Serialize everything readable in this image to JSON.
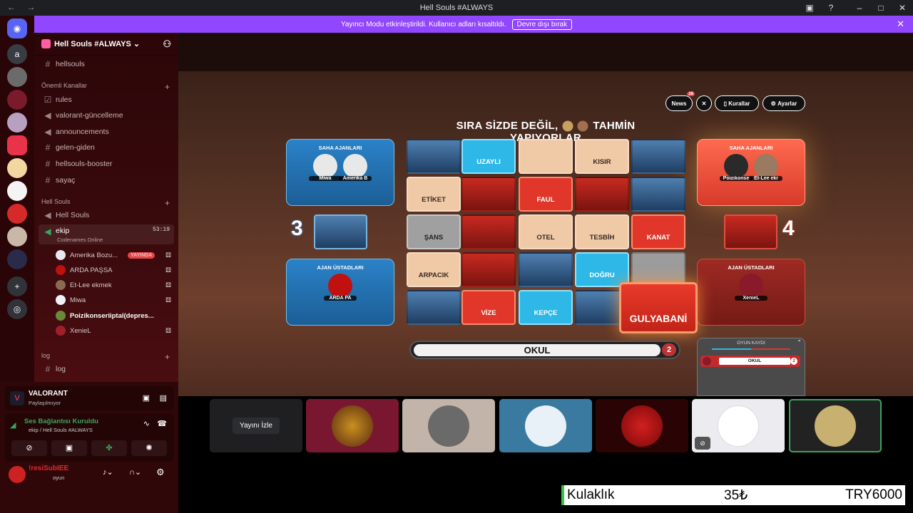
{
  "window": {
    "title": "Hell Souls #ALWAYS",
    "nav": "← →"
  },
  "banner": {
    "text": "Yayıncı Modu etkinleştirildi. Kullanıcı adları kısaltıldı.",
    "button": "Devre dışı bırak"
  },
  "servers": {
    "home_letter": "a"
  },
  "server": {
    "name": "Hell Souls #ALWAYS"
  },
  "channels": {
    "top": "hellsouls",
    "cat1": "Önemli Kanallar",
    "cat1_items": [
      "rules",
      "valorant-güncelleme",
      "announcements",
      "gelen-giden",
      "hellsouls-booster",
      "sayaç"
    ],
    "cat2": "Hell Souls",
    "voice1": "Hell Souls",
    "voice2": "ekip",
    "voice2_time": "53:19",
    "voice2_activity": "Codenames Online",
    "cat3": "log",
    "log": "log"
  },
  "voice_users": [
    {
      "name": "Amerika Bozu...",
      "badge": "YAYINDA",
      "color": "#e8e8f0"
    },
    {
      "name": "ARDA PAŞSA",
      "color": "#c01010"
    },
    {
      "name": "Et-Lee ekmek",
      "color": "#8a6a50"
    },
    {
      "name": "Miwa",
      "color": "#f0f0f8"
    },
    {
      "name": "Poizikonseriiptal(depres...",
      "color": "#6a8a3a"
    },
    {
      "name": "XenieL",
      "color": "#a0202a"
    }
  ],
  "activity": {
    "game": "VALORANT",
    "status": "Paylaşılmıyor"
  },
  "connection": {
    "status": "Ses Bağlantısı Kuruldu",
    "channel": "ekip / Hell Souls #ALWAYS"
  },
  "user": {
    "name": "!resiSubIEE",
    "status": "oyun"
  },
  "game": {
    "buttons": {
      "news": "News",
      "news_count": "28",
      "rules": "Kurallar",
      "settings": "Ayarlar"
    },
    "turn_left": "SIRA SİZDE DEĞİL,",
    "turn_right": "TAHMİN YAPIYORLAR",
    "blue_team": {
      "agents_title": "SAHA AJANLARI",
      "agents": [
        "Miwa",
        "Amerika B"
      ],
      "masters_title": "AJAN ÜSTADLARI",
      "masters": [
        "ARDA PA"
      ],
      "score": "3"
    },
    "red_team": {
      "agents_title": "SAHA AJANLARI",
      "agents": [
        "Poizikonse",
        "Et-Lee ekr"
      ],
      "masters_title": "AJAN ÜSTADLARI",
      "masters": [
        "XenieL"
      ],
      "score": "4"
    },
    "cards": [
      {
        "word": "",
        "type": "bimg"
      },
      {
        "word": "UZAYLI",
        "type": "bw"
      },
      {
        "word": "",
        "type": "beige"
      },
      {
        "word": "KISIR",
        "type": "beige"
      },
      {
        "word": "",
        "type": "bimg"
      },
      {
        "word": "ETİKET",
        "type": "beige"
      },
      {
        "word": "",
        "type": "rimg"
      },
      {
        "word": "FAUL",
        "type": "rw"
      },
      {
        "word": "",
        "type": "rimg"
      },
      {
        "word": "",
        "type": "bimg"
      },
      {
        "word": "ŞANS",
        "type": "neutral"
      },
      {
        "word": "",
        "type": "rimg"
      },
      {
        "word": "OTEL",
        "type": "beige"
      },
      {
        "word": "TESBİH",
        "type": "beige"
      },
      {
        "word": "KANAT",
        "type": "rw"
      },
      {
        "word": "ARPACIK",
        "type": "beige"
      },
      {
        "word": "",
        "type": "rimg"
      },
      {
        "word": "",
        "type": "bimg"
      },
      {
        "word": "DOĞRU",
        "type": "bw"
      },
      {
        "word": "",
        "type": "gray"
      },
      {
        "word": "",
        "type": "bimg"
      },
      {
        "word": "VİZE",
        "type": "rw"
      },
      {
        "word": "KEPÇE",
        "type": "bw"
      },
      {
        "word": "",
        "type": "bimg"
      },
      {
        "word": "",
        "type": "gray"
      }
    ],
    "highlight_card": "GULYABANİ",
    "clue": {
      "word": "OKUL",
      "count": "2"
    },
    "log": {
      "title": "OYUN KAYDI",
      "entry_word": "OKUL",
      "entry_count": "2"
    }
  },
  "stream": {
    "watch_button": "Yayını İzle"
  },
  "overlay": {
    "item": "Kulaklık",
    "price": "35₺",
    "total": "TRY6000"
  }
}
